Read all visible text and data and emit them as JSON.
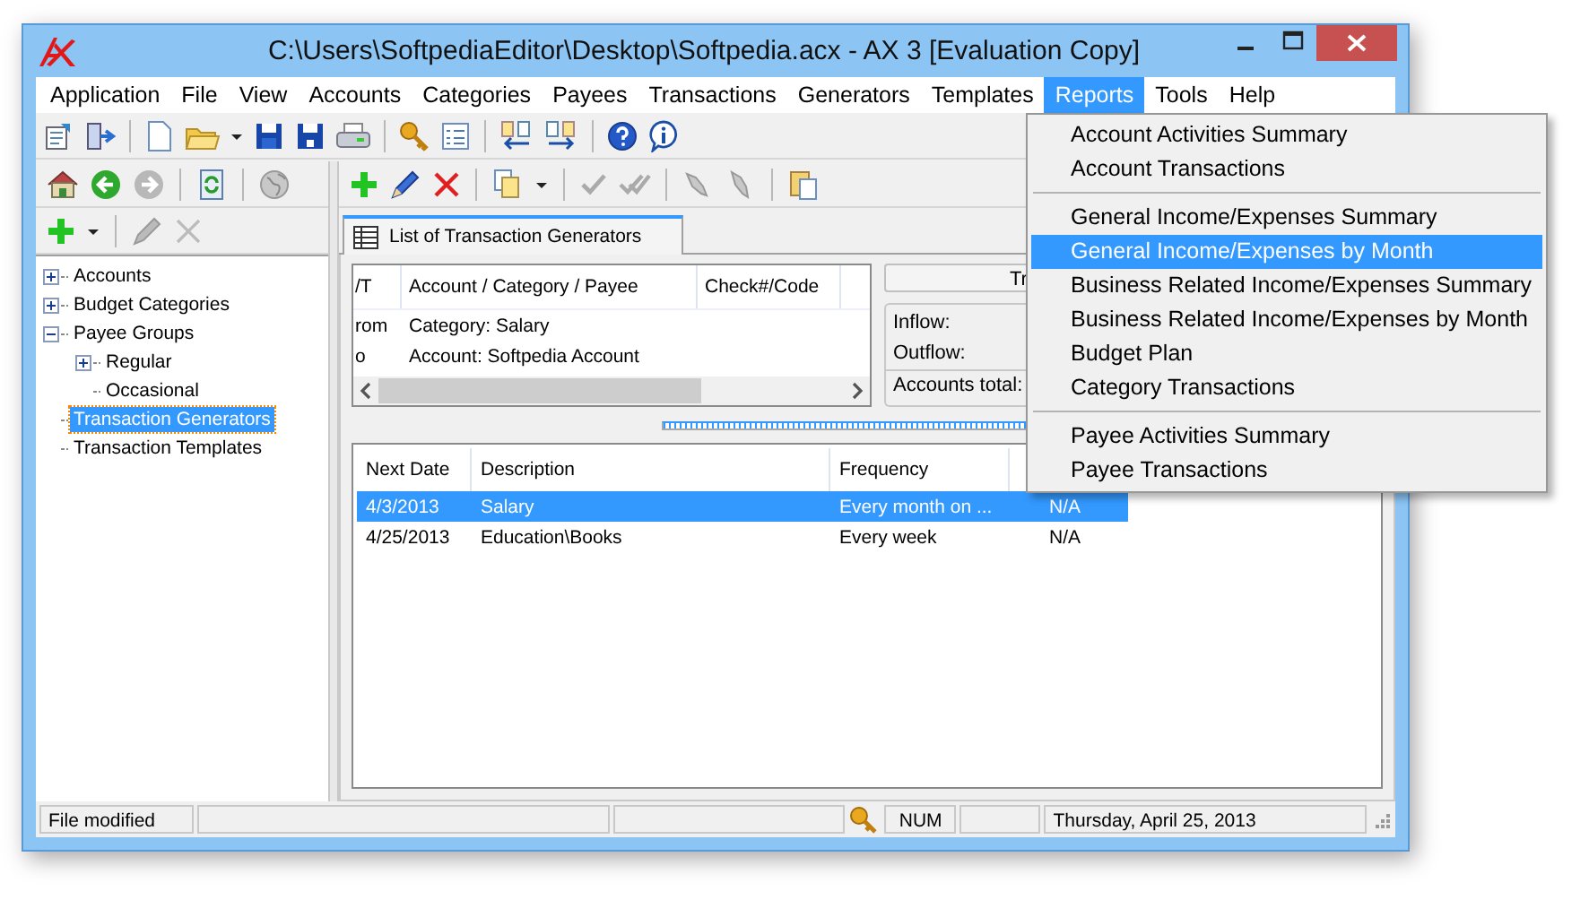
{
  "window": {
    "title": "C:\\Users\\SoftpediaEditor\\Desktop\\Softpedia.acx - AX 3 [Evaluation Copy]"
  },
  "menu": [
    {
      "label": "Application",
      "selected": false
    },
    {
      "label": "File",
      "selected": false
    },
    {
      "label": "View",
      "selected": false
    },
    {
      "label": "Accounts",
      "selected": false
    },
    {
      "label": "Categories",
      "selected": false
    },
    {
      "label": "Payees",
      "selected": false
    },
    {
      "label": "Transactions",
      "selected": false
    },
    {
      "label": "Generators",
      "selected": false
    },
    {
      "label": "Templates",
      "selected": false
    },
    {
      "label": "Reports",
      "selected": true
    },
    {
      "label": "Tools",
      "selected": false
    },
    {
      "label": "Help",
      "selected": false
    }
  ],
  "reports_menu": {
    "groups": [
      {
        "items": [
          {
            "label": "Account Activities Summary",
            "selected": false
          },
          {
            "label": "Account Transactions",
            "selected": false
          }
        ]
      },
      {
        "items": [
          {
            "label": "General Income/Expenses Summary",
            "selected": false
          },
          {
            "label": "General Income/Expenses by Month",
            "selected": true
          },
          {
            "label": "Business Related Income/Expenses Summary",
            "selected": false
          },
          {
            "label": "Business Related Income/Expenses by Month",
            "selected": false
          },
          {
            "label": "Budget Plan",
            "selected": false
          },
          {
            "label": "Category Transactions",
            "selected": false
          }
        ]
      },
      {
        "items": [
          {
            "label": "Payee Activities Summary",
            "selected": false
          },
          {
            "label": "Payee Transactions",
            "selected": false
          }
        ]
      }
    ]
  },
  "tree": [
    {
      "label": "Accounts",
      "expanded": false,
      "selected": false
    },
    {
      "label": "Budget Categories",
      "expanded": false,
      "selected": false
    },
    {
      "label": "Payee Groups",
      "expanded": true,
      "selected": false,
      "children": [
        {
          "label": "Regular",
          "expanded": false,
          "selected": false
        },
        {
          "label": "Occasional",
          "selected": false
        }
      ]
    },
    {
      "label": "Transaction Generators",
      "selected": true
    },
    {
      "label": "Transaction Templates",
      "selected": false
    }
  ],
  "tab": {
    "label": "List of Transaction Generators"
  },
  "splits_grid": {
    "columns": [
      "/T",
      "Account / Category / Payee",
      "Check#/Code"
    ],
    "rows": [
      [
        "rom",
        "Category: Salary"
      ],
      [
        "o",
        "Account: Softpedia Account"
      ]
    ]
  },
  "totals": {
    "header": "Tr",
    "labels": [
      "Inflow:",
      "Outflow:",
      "Accounts total:"
    ]
  },
  "generators": {
    "columns": [
      "Next Date",
      "Description",
      "Frequency"
    ],
    "rows": [
      {
        "cells": [
          "4/3/2013",
          "Salary",
          "Every month on ...",
          "N/A"
        ],
        "selected": true
      },
      {
        "cells": [
          "4/25/2013",
          "Education\\Books",
          "Every week",
          "N/A"
        ],
        "selected": false
      }
    ]
  },
  "status_bar": {
    "message": "File modified",
    "num": "NUM",
    "date": "Thursday, April 25, 2013"
  }
}
